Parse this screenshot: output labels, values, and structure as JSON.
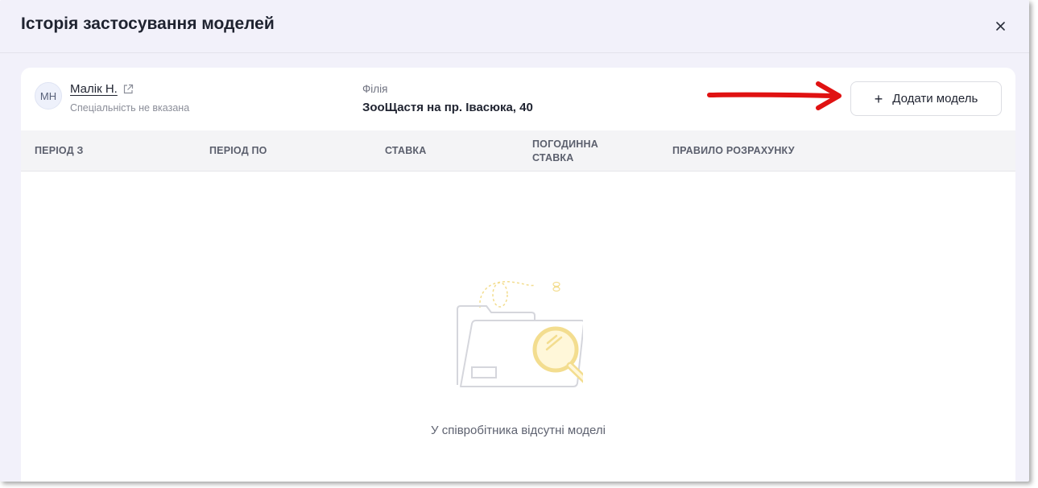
{
  "modal": {
    "title": "Історія застосування моделей"
  },
  "employee": {
    "initials": "МН",
    "name": "Малік Н.",
    "speciality": "Спеціальність не вказана"
  },
  "branch": {
    "label": "Філія",
    "value": "ЗооЩастя на пр. Івасюка, 40"
  },
  "actions": {
    "add_model_label": "Додати модель"
  },
  "table": {
    "columns": [
      "ПЕРІОД З",
      "ПЕРІОД ПО",
      "СТАВКА",
      "ПОГОДИННА СТАВКА",
      "ПРАВИЛО РОЗРАХУНКУ"
    ]
  },
  "empty_state": {
    "message": "У співробітника відсутні моделі"
  },
  "colors": {
    "modal_bg": "#f2f1fa",
    "card_bg": "#ffffff",
    "table_header_bg": "#f4f4f6",
    "annotation_arrow": "#e01212",
    "illustration_accent": "#f3dd8f"
  },
  "icons": {
    "close": "close-icon",
    "external_link": "external-link-icon",
    "plus": "plus-icon",
    "empty": "empty-folder-search-icon"
  }
}
